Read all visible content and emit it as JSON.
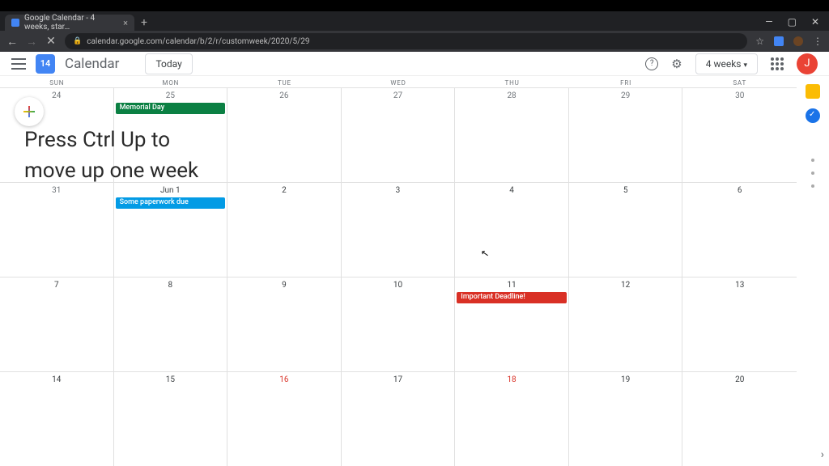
{
  "browser": {
    "tab_title": "Google Calendar - 4 weeks, star…",
    "url": "calendar.google.com/calendar/b/2/r/customweek/2020/5/29",
    "nav": {
      "back": "←",
      "forward": "→",
      "reload": "✕",
      "star": "☆",
      "menu": "⋮"
    },
    "win": {
      "min": "—",
      "max": "▢",
      "close": "✕"
    }
  },
  "header": {
    "logo_day": "14",
    "app_name": "Calendar",
    "today_label": "Today",
    "help_icon": "?",
    "settings_icon": "⚙",
    "view_label": "4 weeks",
    "avatar_letter": "J"
  },
  "overlay": {
    "line1": "Press Ctrl Up to",
    "line2": "move up one week"
  },
  "day_names": [
    "SUN",
    "MON",
    "TUE",
    "WED",
    "THU",
    "FRI",
    "SAT"
  ],
  "weeks": [
    {
      "dates": [
        "24",
        "25",
        "26",
        "27",
        "28",
        "29",
        "30"
      ],
      "muted": [
        true,
        true,
        true,
        true,
        true,
        true,
        true
      ]
    },
    {
      "dates": [
        "31",
        "Jun 1",
        "2",
        "3",
        "4",
        "5",
        "6"
      ],
      "muted": [
        true,
        false,
        false,
        false,
        false,
        false,
        false
      ]
    },
    {
      "dates": [
        "7",
        "8",
        "9",
        "10",
        "11",
        "12",
        "13"
      ],
      "muted": [
        false,
        false,
        false,
        false,
        false,
        false,
        false
      ]
    },
    {
      "dates": [
        "14",
        "15",
        "16",
        "17",
        "18",
        "19",
        "20"
      ],
      "muted": [
        false,
        false,
        false,
        false,
        false,
        false,
        false
      ]
    }
  ],
  "events": {
    "memorial": "Memorial Day",
    "paperwork": "Some paperwork due",
    "deadline": "Important Deadline!"
  },
  "sidepanel_chevron": "›"
}
